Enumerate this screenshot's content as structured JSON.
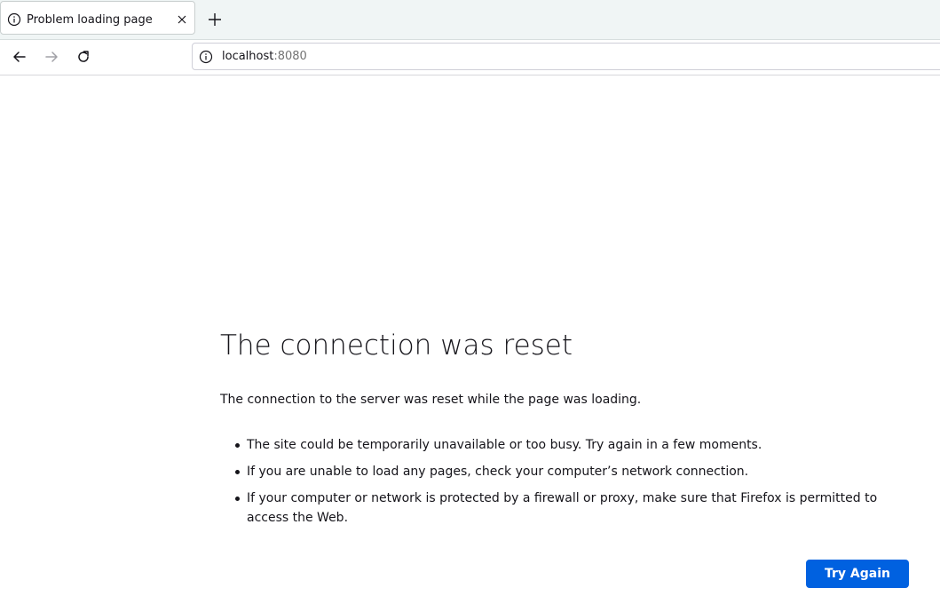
{
  "tab": {
    "title": "Problem loading page",
    "icon": "info-icon",
    "close_icon": "close-icon",
    "new_tab_icon": "plus-icon"
  },
  "nav": {
    "back_icon": "back-arrow-icon",
    "forward_icon": "forward-arrow-icon",
    "reload_icon": "reload-icon"
  },
  "urlbar": {
    "host": "localhost",
    "port": ":8080",
    "icon": "info-icon"
  },
  "error": {
    "title": "The connection was reset",
    "description": "The connection to the server was reset while the page was loading.",
    "items": [
      "The site could be temporarily unavailable or too busy. Try again in a few moments.",
      "If you are unable to load any pages, check your computer’s network connection.",
      "If your computer or network is protected by a firewall or proxy, make sure that Firefox is permitted to access the Web."
    ],
    "button_label": "Try Again"
  },
  "colors": {
    "accent": "#0061e0",
    "tabbar_bg": "#f0f5f5",
    "text": "#15141a"
  }
}
